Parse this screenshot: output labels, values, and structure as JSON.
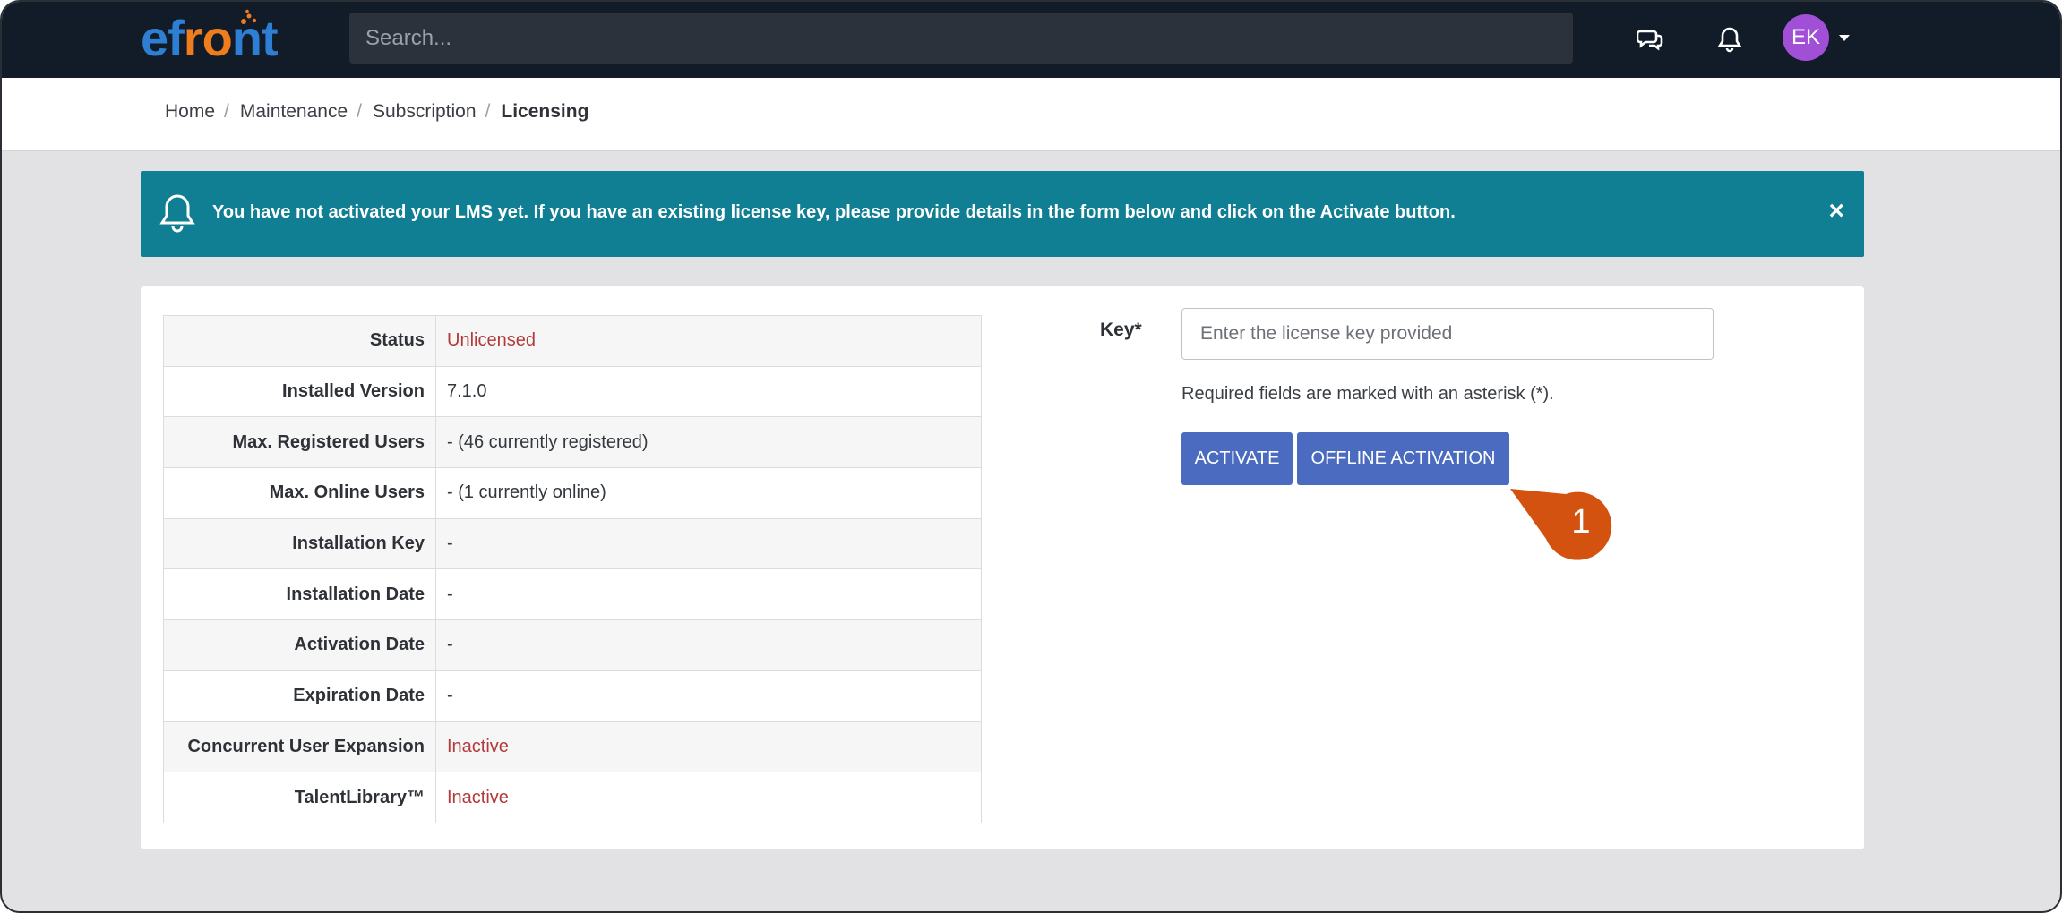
{
  "topbar": {
    "logo": {
      "part1": "ef",
      "part2": "ro",
      "part3": "nt"
    },
    "search_placeholder": "Search...",
    "avatar_initials": "EK"
  },
  "breadcrumb": {
    "items": [
      "Home",
      "Maintenance",
      "Subscription"
    ],
    "current": "Licensing",
    "separator": "/"
  },
  "alert": {
    "message": "You have not activated your LMS yet. If you have an existing license key, please provide details in the form below and click on the Activate button.",
    "close_label": "×",
    "color": "#117f93"
  },
  "license_table": {
    "rows": [
      {
        "label": "Status",
        "value": "Unlicensed"
      },
      {
        "label": "Installed Version",
        "value": "7.1.0"
      },
      {
        "label": "Max. Registered Users",
        "value": "- (46 currently registered)"
      },
      {
        "label": "Max. Online Users",
        "value": "- (1 currently online)"
      },
      {
        "label": "Installation Key",
        "value": "-"
      },
      {
        "label": "Installation Date",
        "value": "-"
      },
      {
        "label": "Activation Date",
        "value": "-"
      },
      {
        "label": "Expiration Date",
        "value": "-"
      },
      {
        "label": "Concurrent User Expansion",
        "value": "Inactive"
      },
      {
        "label": "TalentLibrary™",
        "value": "Inactive"
      }
    ]
  },
  "form": {
    "key_label": "Key*",
    "key_placeholder": "Enter the license key provided",
    "key_value": "",
    "required_note": "Required fields are marked with an asterisk (*).",
    "activate_label": "ACTIVATE",
    "offline_label": "OFFLINE ACTIVATION"
  },
  "callout": {
    "number": "1",
    "color": "#d4520f"
  },
  "colors": {
    "topbar": "#121c28",
    "button": "#4a6bbf",
    "inactive_text": "#b33a3a"
  }
}
